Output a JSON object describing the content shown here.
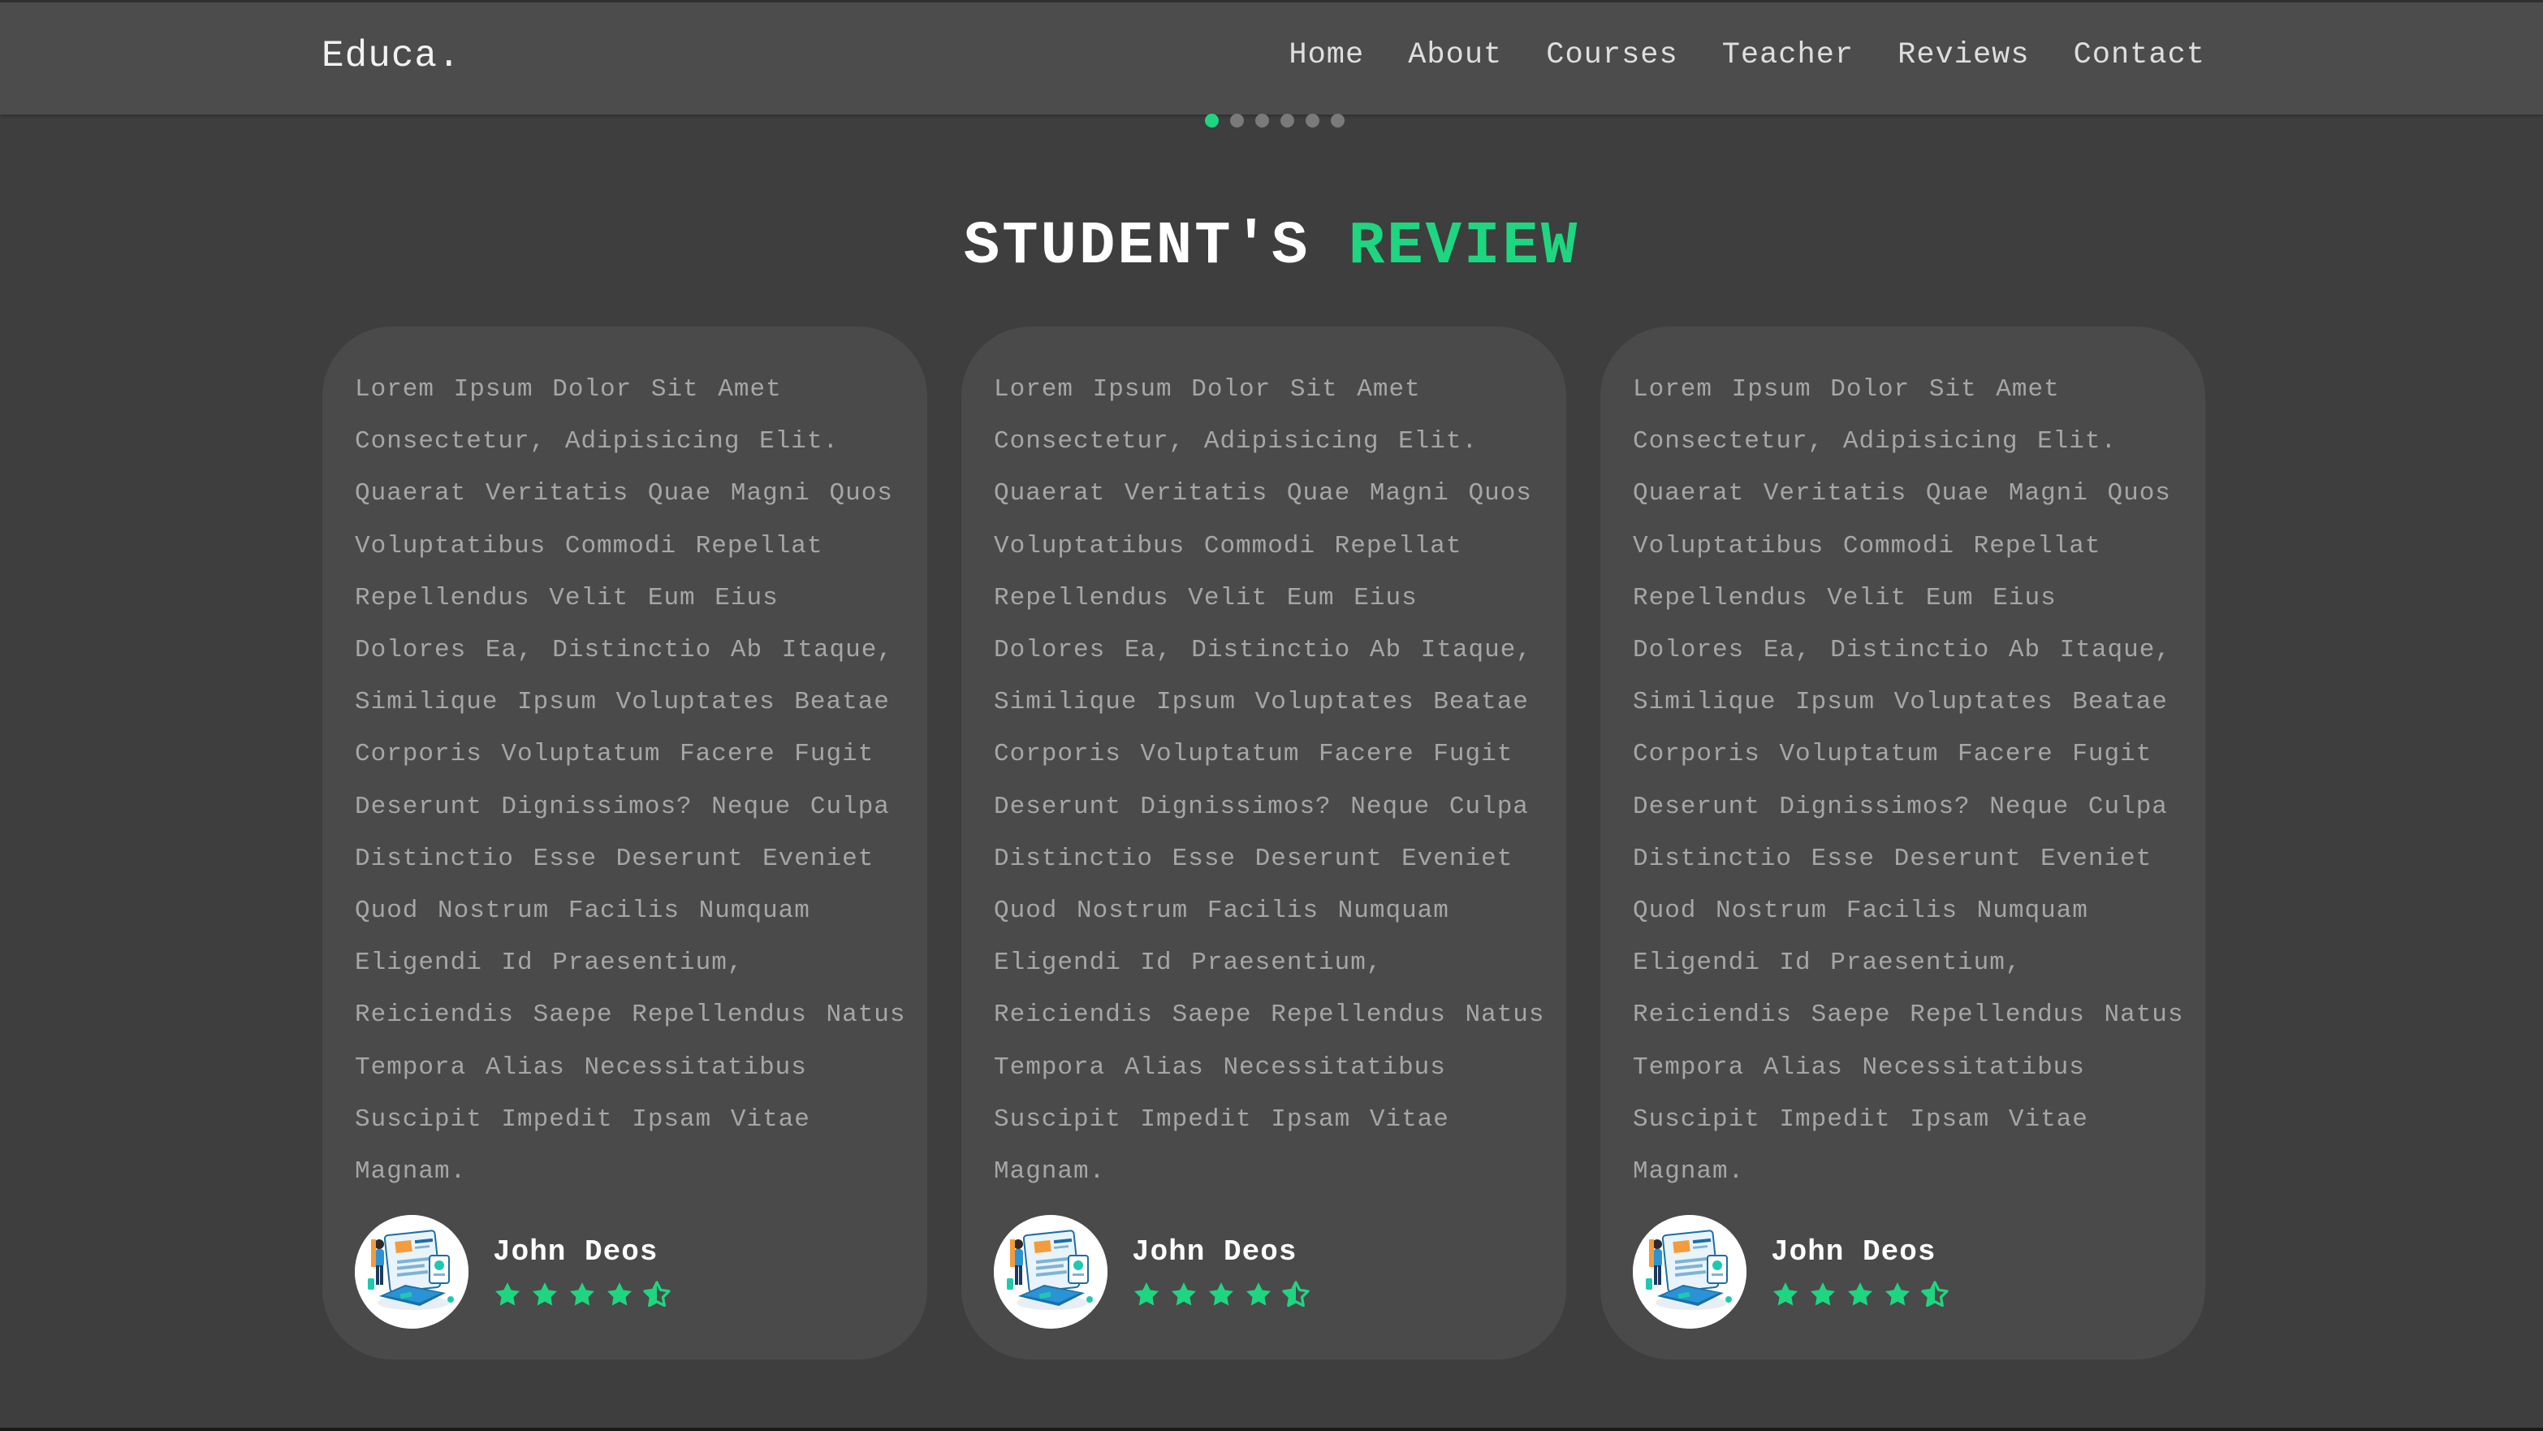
{
  "header": {
    "logo": "Educa.",
    "nav": [
      "Home",
      "About",
      "Courses",
      "Teacher",
      "Reviews",
      "Contact"
    ]
  },
  "slider": {
    "total": 6,
    "active": 0
  },
  "section": {
    "title_main": "STUDENT'S",
    "title_accent": "REVIEW"
  },
  "reviews": [
    {
      "text": "Lorem Ipsum Dolor Sit Amet Consectetur, Adipisicing Elit. Quaerat Veritatis Quae Magni Quos Voluptatibus Commodi Repellat Repellendus Velit Eum Eius Dolores Ea, Distinctio Ab Itaque, Similique Ipsum Voluptates Beatae Corporis Voluptatum Facere Fugit Deserunt Dignissimos? Neque Culpa Distinctio Esse Deserunt Eveniet Quod Nostrum Facilis Numquam Eligendi Id Praesentium, Reiciendis Saepe Repellendus Natus Tempora Alias Necessitatibus Suscipit Impedit Ipsam Vitae Magnam.",
      "name": "John Deos",
      "rating": 4.5
    },
    {
      "text": "Lorem Ipsum Dolor Sit Amet Consectetur, Adipisicing Elit. Quaerat Veritatis Quae Magni Quos Voluptatibus Commodi Repellat Repellendus Velit Eum Eius Dolores Ea, Distinctio Ab Itaque, Similique Ipsum Voluptates Beatae Corporis Voluptatum Facere Fugit Deserunt Dignissimos? Neque Culpa Distinctio Esse Deserunt Eveniet Quod Nostrum Facilis Numquam Eligendi Id Praesentium, Reiciendis Saepe Repellendus Natus Tempora Alias Necessitatibus Suscipit Impedit Ipsam Vitae Magnam.",
      "name": "John Deos",
      "rating": 4.5
    },
    {
      "text": "Lorem Ipsum Dolor Sit Amet Consectetur, Adipisicing Elit. Quaerat Veritatis Quae Magni Quos Voluptatibus Commodi Repellat Repellendus Velit Eum Eius Dolores Ea, Distinctio Ab Itaque, Similique Ipsum Voluptates Beatae Corporis Voluptatum Facere Fugit Deserunt Dignissimos? Neque Culpa Distinctio Esse Deserunt Eveniet Quod Nostrum Facilis Numquam Eligendi Id Praesentium, Reiciendis Saepe Repellendus Natus Tempora Alias Necessitatibus Suscipit Impedit Ipsam Vitae Magnam.",
      "name": "John Deos",
      "rating": 4.5
    }
  ],
  "icons": {
    "avatar": "student-illustration-icon",
    "star": "star-icon",
    "half_star": "star-half-icon"
  },
  "colors": {
    "accent": "#1fd680",
    "background": "#3e3e3e",
    "header": "#4c4c4c",
    "card": "#4a4a4a",
    "text_muted": "#a6a6a6"
  }
}
